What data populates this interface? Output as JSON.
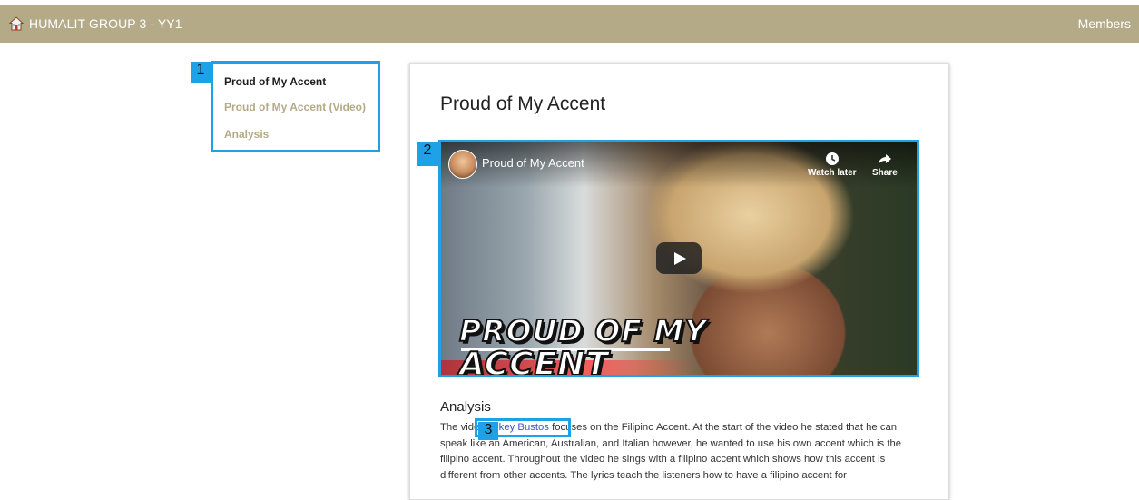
{
  "topbar": {
    "brand": "HUMALIT GROUP 3 - YY1",
    "members": "Members",
    "home_icon": "home-icon"
  },
  "sidenav": {
    "items": [
      {
        "label": "Proud of My Accent",
        "active": true
      },
      {
        "label": "Proud of My Accent (Video)",
        "active": false
      },
      {
        "label": "Analysis",
        "active": false
      }
    ]
  },
  "main": {
    "title": "Proud of My Accent",
    "video": {
      "title": "Proud of My Accent",
      "watch_later": "Watch later",
      "share": "Share",
      "thumbnail_line1": "PROUD OF MY",
      "thumbnail_line2": "ACCENT"
    },
    "analysis": {
      "heading": "Analysis",
      "text_before_link": "The video ",
      "link_text": "Mikey Bustos",
      "text_after_link": " focuses on the Filipino Accent. At the start of the video he stated that he can speak like an American, Australian, and Italian however, he wanted to use his own accent which is the filipino accent. Throughout the video he sings with a filipino accent which shows how this accent is different from other accents. The lyrics teach the listeners how to have a filipino accent for"
    }
  },
  "annotations": [
    "1",
    "2",
    "3"
  ],
  "colors": {
    "topbar": "#b5aa88",
    "annotation": "#1ea1e6",
    "link": "#3a55c2"
  }
}
